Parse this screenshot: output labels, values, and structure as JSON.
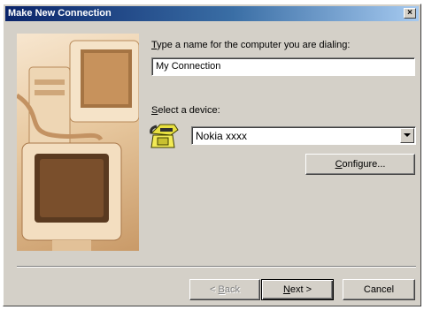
{
  "window": {
    "title": "Make New Connection",
    "close_glyph": "×"
  },
  "form": {
    "name_label_first": "T",
    "name_label_rest": "ype a name for the computer you are dialing:",
    "name_value": "My Connection",
    "device_label_first": "S",
    "device_label_rest": "elect a device:",
    "device_icon": "modem-phone-icon",
    "device_selected": "Nokia xxxx"
  },
  "buttons": {
    "configure_first": "C",
    "configure_rest": "onfigure...",
    "back_prefix": "< ",
    "back_first": "B",
    "back_rest": "ack",
    "next_first": "N",
    "next_rest": "ext >",
    "cancel": "Cancel"
  },
  "colors": {
    "title_bar": "#0a246a",
    "face": "#d4d0c8"
  }
}
